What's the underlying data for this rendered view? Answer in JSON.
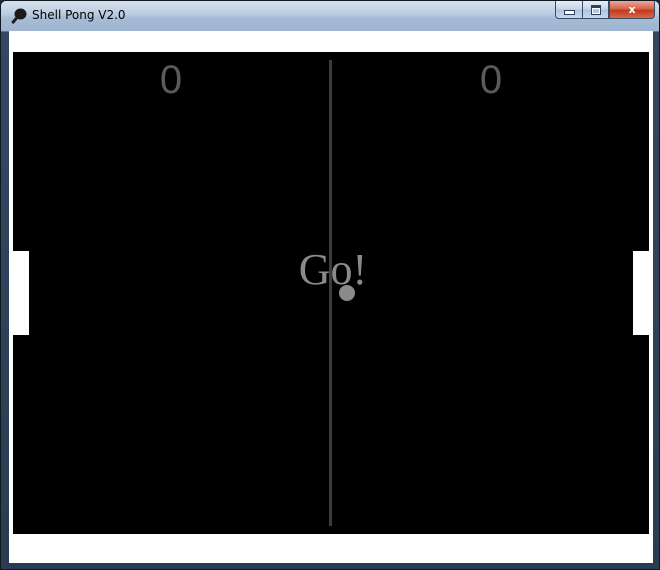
{
  "window": {
    "title": "Shell Pong V2.0",
    "icon": "ping-pong-paddle-icon",
    "controls": {
      "minimize": "minimize-icon",
      "maximize": "maximize-icon",
      "close_label": "x"
    }
  },
  "game": {
    "score_left": "0",
    "score_right": "0",
    "message": "Go!",
    "colors": {
      "court": "#000000",
      "walls": "#ffffff",
      "paddles": "#ffffff",
      "center_line": "#3c3c3c",
      "score_text": "#5a5a5a",
      "message_text": "#8a8a8a",
      "ball": "#8a8a8a"
    }
  }
}
